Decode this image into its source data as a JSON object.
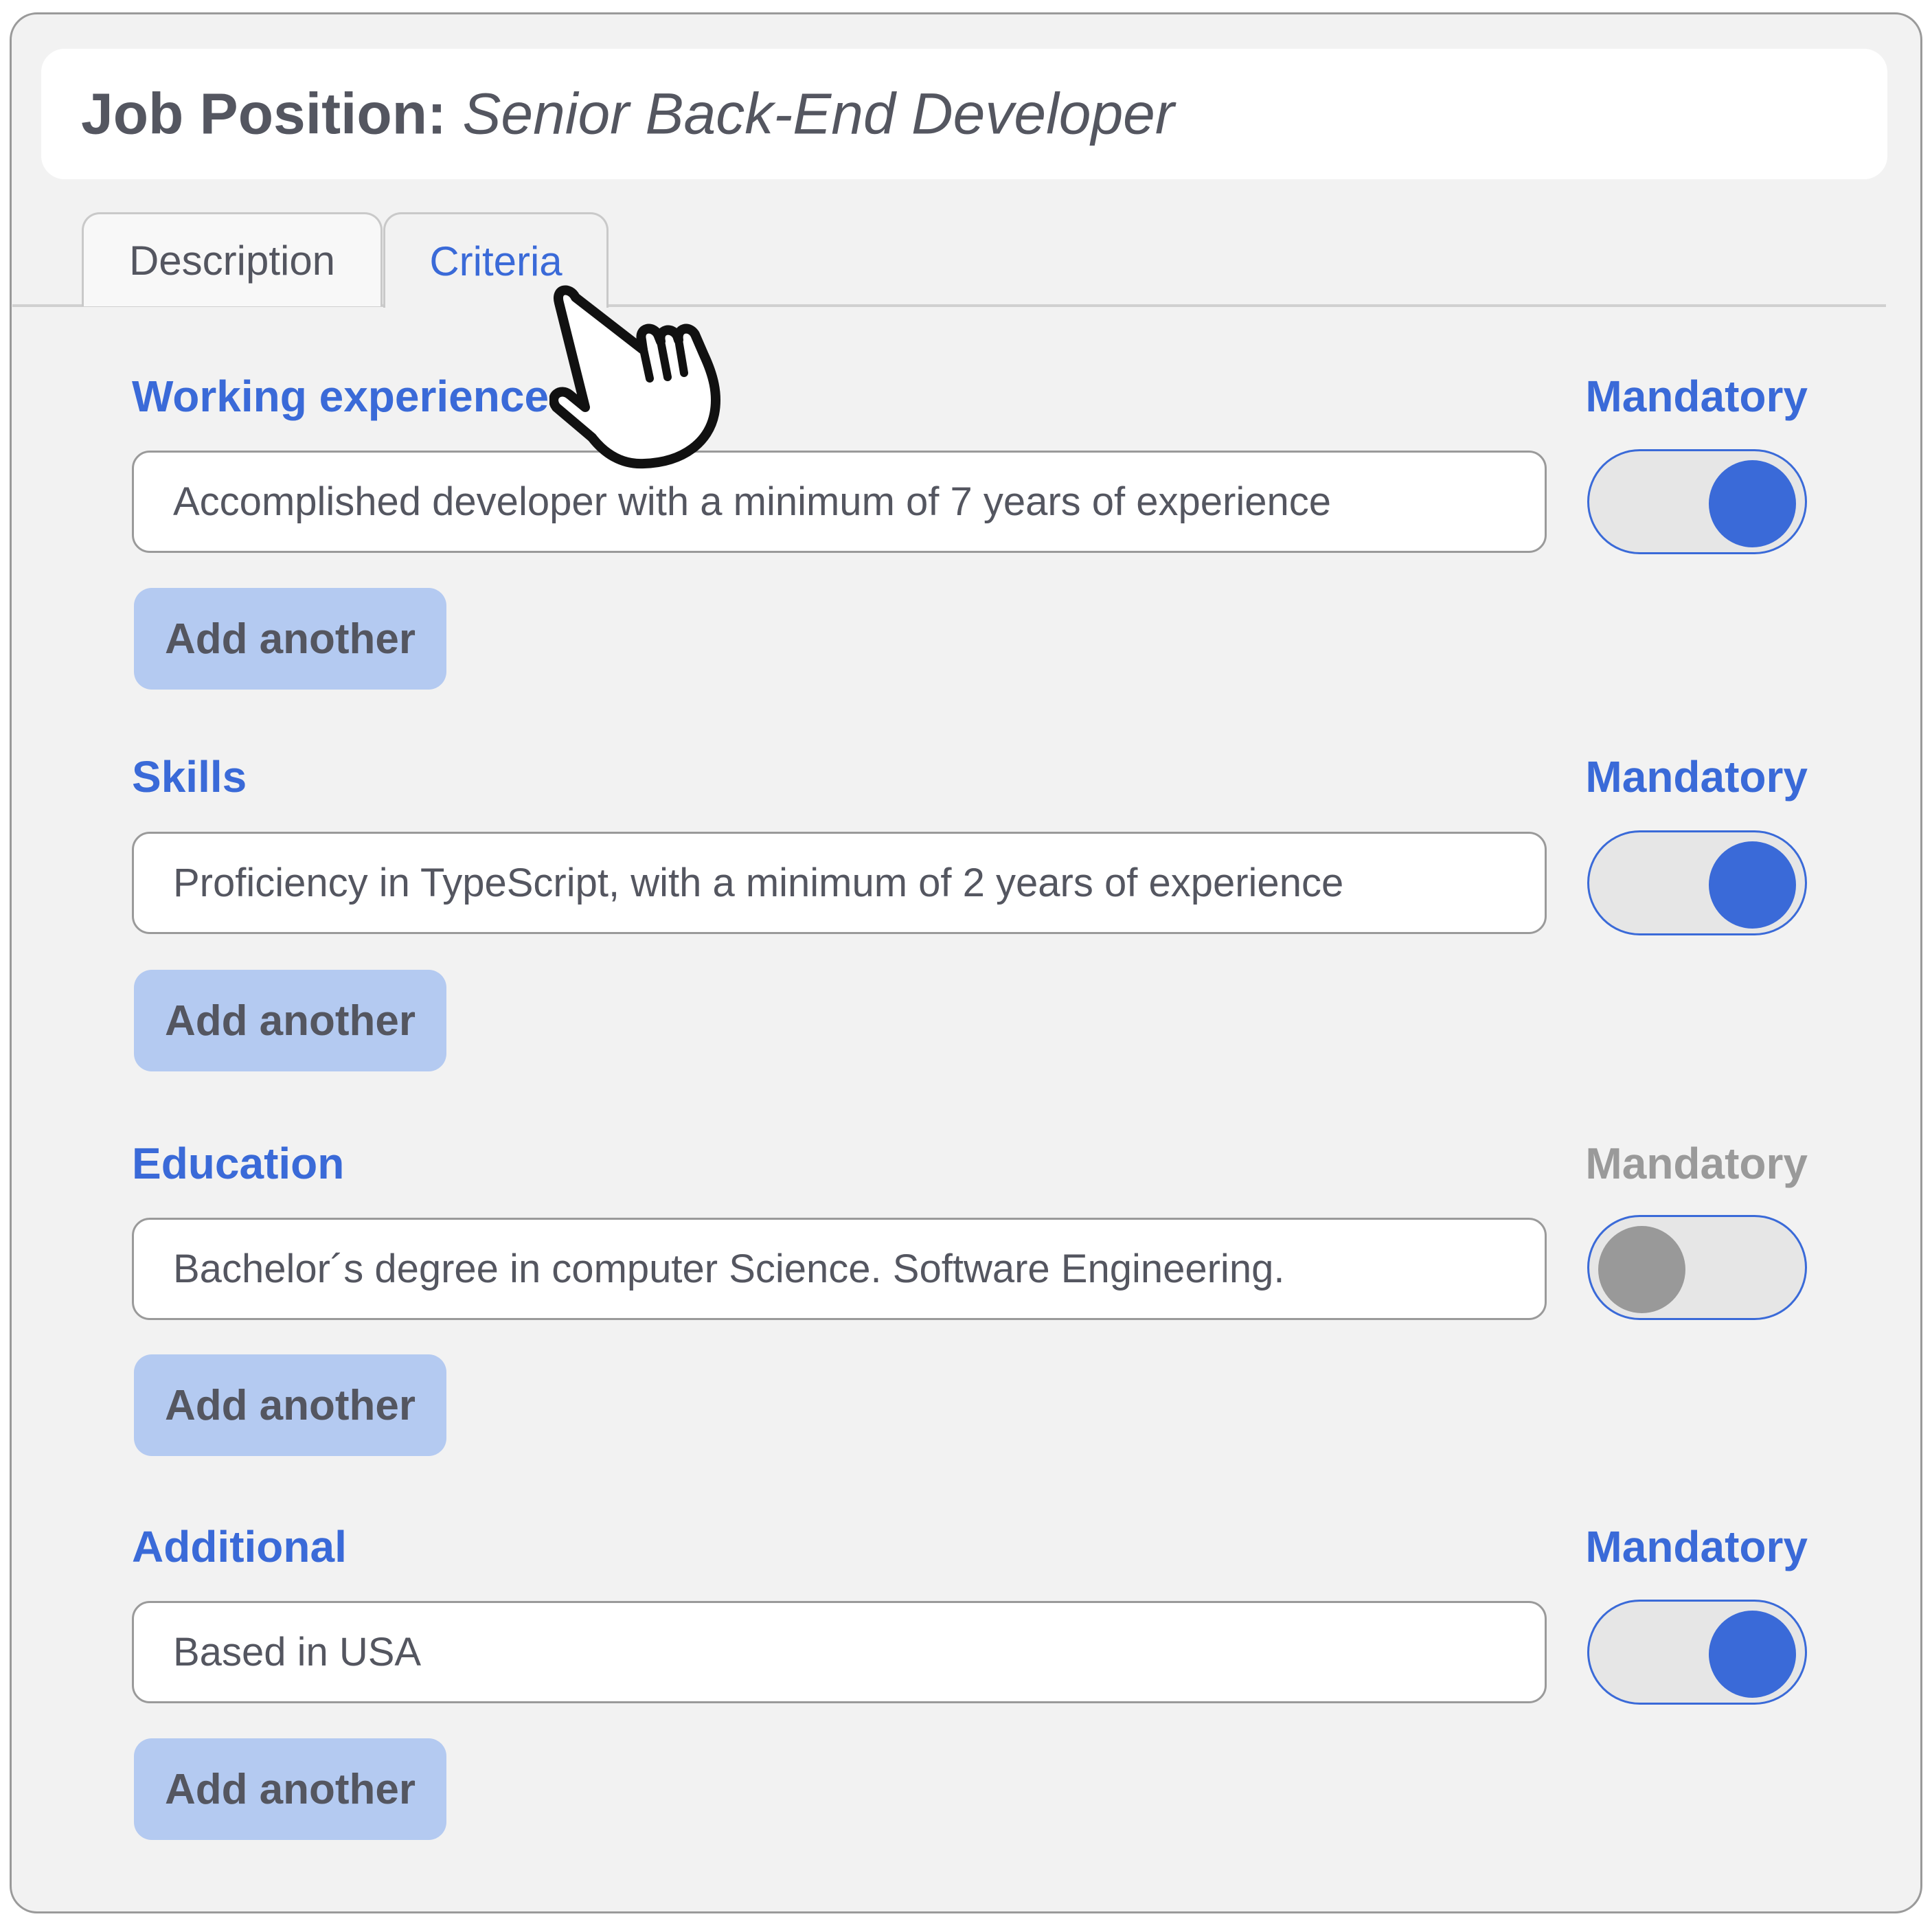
{
  "header": {
    "prefix": "Job Position:",
    "position_title": "Senior Back-End Developer"
  },
  "tabs": [
    {
      "label": "Description",
      "active": false
    },
    {
      "label": "Criteria",
      "active": true
    }
  ],
  "sections": [
    {
      "label": "Working experience",
      "mandatory_label": "Mandatory",
      "mandatory": true,
      "value": "Accomplished developer with a minimum of 7 years of experience",
      "add_label": "Add another"
    },
    {
      "label": "Skills",
      "mandatory_label": "Mandatory",
      "mandatory": true,
      "value": "Proficiency in TypeScript, with a minimum of 2 years of experience",
      "add_label": "Add another"
    },
    {
      "label": "Education",
      "mandatory_label": "Mandatory",
      "mandatory": false,
      "value": "Bachelor´s degree in computer Science. Software Engineering.",
      "add_label": "Add another"
    },
    {
      "label": "Additional",
      "mandatory_label": "Mandatory",
      "mandatory": true,
      "value": "Based in USA",
      "add_label": "Add another"
    }
  ],
  "cursor": {
    "icon": "hand-pointer-icon"
  },
  "colors": {
    "accent": "#3a6ad8",
    "button_bg": "#b4caf1",
    "text": "#545660",
    "toggle_off_knob": "#999999"
  }
}
